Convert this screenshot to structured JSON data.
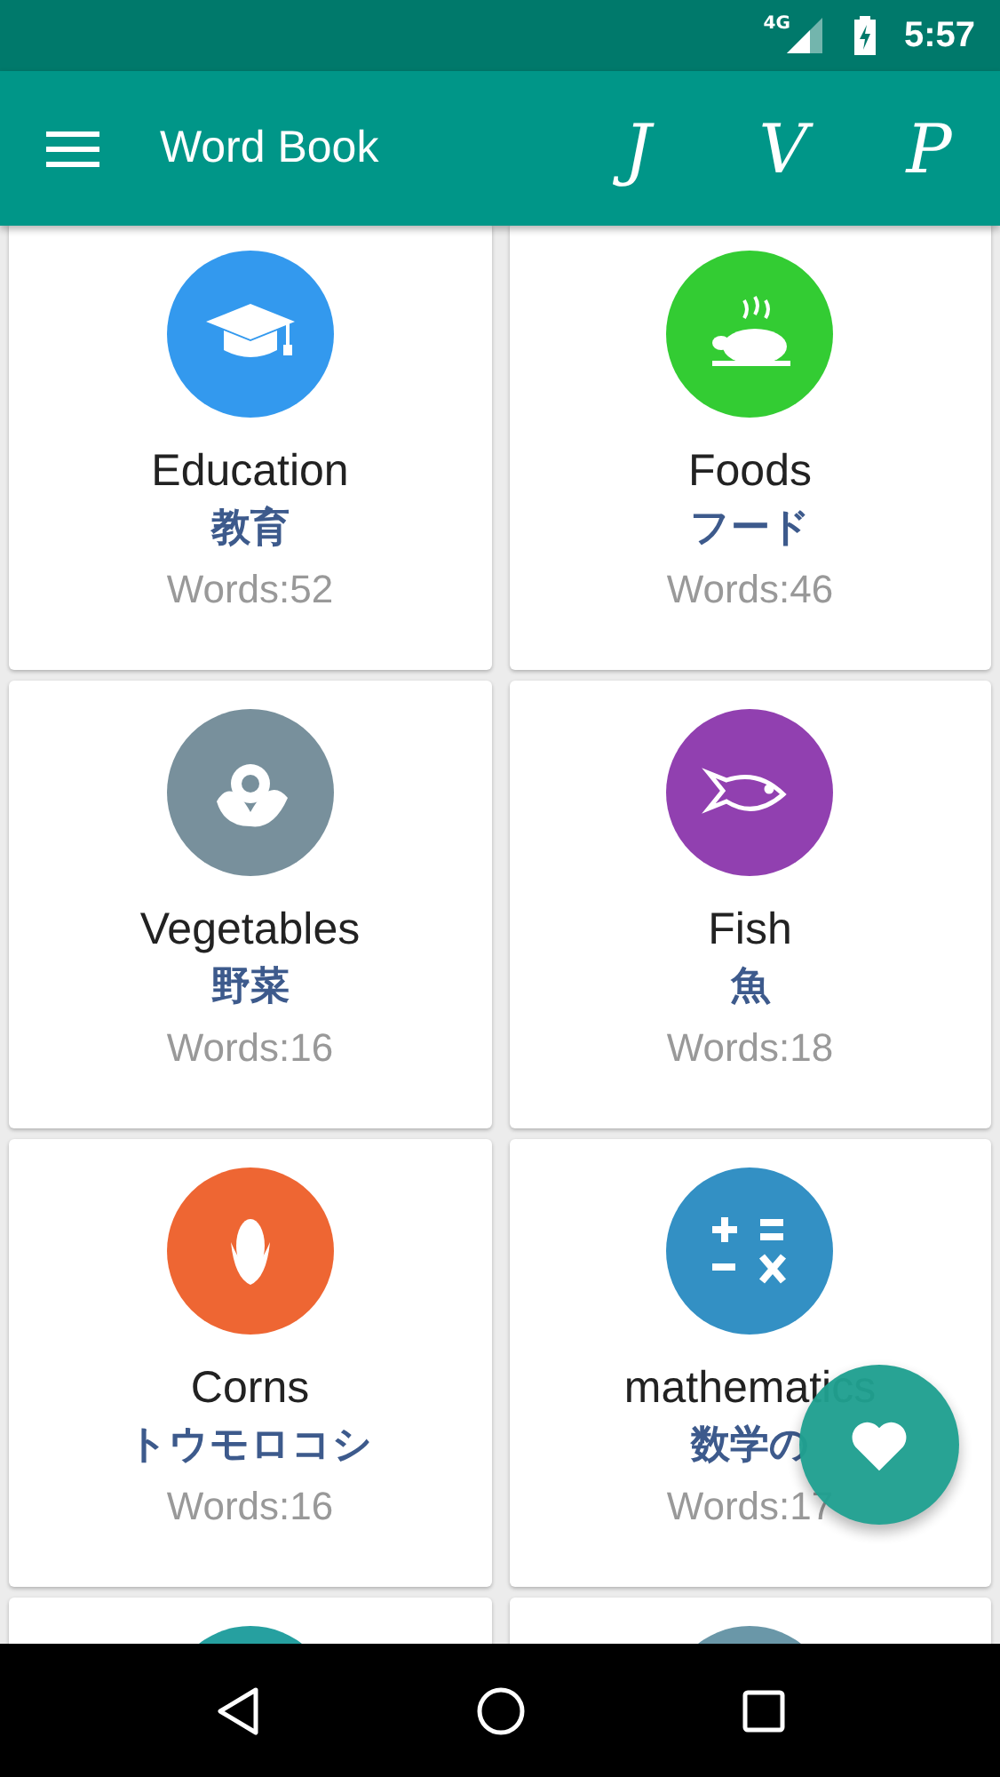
{
  "status_bar": {
    "network": "4G",
    "time": "5:57"
  },
  "app_bar": {
    "title": "Word Book",
    "actions": [
      "J",
      "V",
      "P"
    ]
  },
  "categories": [
    {
      "name": "Education",
      "japanese": "教育",
      "count": "Words:52",
      "color": "#3399ee"
    },
    {
      "name": "Foods",
      "japanese": "フード",
      "count": "Words:46",
      "color": "#33cc33"
    },
    {
      "name": "Vegetables",
      "japanese": "野菜",
      "count": "Words:16",
      "color": "#78909c"
    },
    {
      "name": "Fish",
      "japanese": "魚",
      "count": "Words:18",
      "color": "#9140b0"
    },
    {
      "name": "Corns",
      "japanese": "トウモロコシ",
      "count": "Words:16",
      "color": "#ee6633"
    },
    {
      "name": "mathematics",
      "japanese": "数学の",
      "count": "Words:17",
      "color": "#3390c4"
    },
    {
      "color": "#26a0a0"
    },
    {
      "color": "#6a97a8"
    }
  ]
}
